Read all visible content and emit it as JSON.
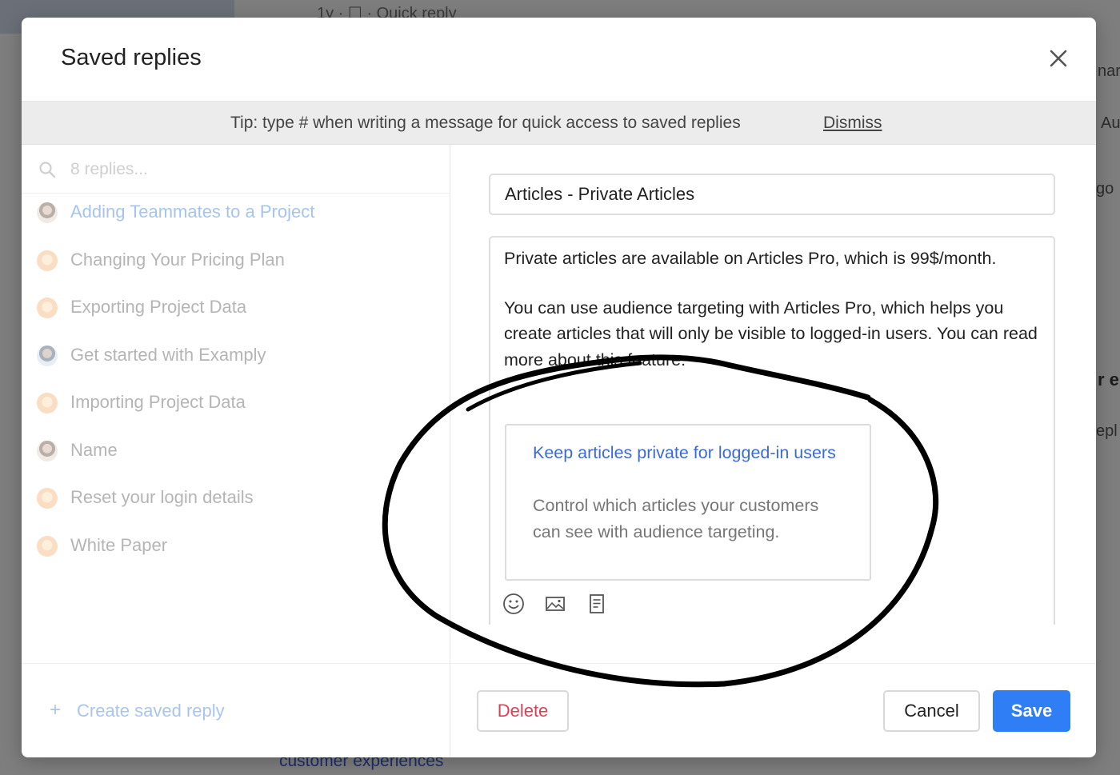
{
  "background": {
    "top_text": "1y · ☐ · Quick reply",
    "right_fragments": [
      "nar",
      "Au",
      "go",
      "r e",
      "epl"
    ],
    "bottom_text": "customer experiences"
  },
  "modal": {
    "title": "Saved replies",
    "close_icon": "close-icon"
  },
  "tip": {
    "text": "Tip: type # when writing a message for quick access to saved replies",
    "dismiss_label": "Dismiss"
  },
  "search": {
    "placeholder": "8 replies...",
    "icon": "search-icon"
  },
  "replies": [
    {
      "label": "Adding Teammates to a Project",
      "active": true,
      "avatar": "person-photo"
    },
    {
      "label": "Changing Your Pricing Plan",
      "active": false,
      "avatar": "illustrated-face"
    },
    {
      "label": "Exporting Project Data",
      "active": false,
      "avatar": "illustrated-face"
    },
    {
      "label": "Get started with Examply",
      "active": false,
      "avatar": "person-photo-blue"
    },
    {
      "label": "Importing Project Data",
      "active": false,
      "avatar": "illustrated-face"
    },
    {
      "label": "Name",
      "active": false,
      "avatar": "person-photo"
    },
    {
      "label": "Reset your login details",
      "active": false,
      "avatar": "illustrated-face"
    },
    {
      "label": "White Paper",
      "active": false,
      "avatar": "illustrated-face"
    }
  ],
  "create_reply_label": "Create saved reply",
  "editor": {
    "title_value": "Articles - Private Articles",
    "paragraphs": [
      "Private articles are available on Articles Pro, which is 99$/month.",
      "You can use audience targeting with Articles Pro, which helps you create articles that will only be visible to logged-in users. You can read more about this feature:"
    ],
    "link_card": {
      "title": "Keep articles private for logged-in users",
      "description": "Control which articles your customers can see with audience targeting."
    },
    "toolbar": [
      "emoji-icon",
      "image-icon",
      "article-icon"
    ]
  },
  "actions": {
    "delete_label": "Delete",
    "cancel_label": "Cancel",
    "save_label": "Save"
  },
  "colors": {
    "accent": "#2f7ef6",
    "danger": "#e23d56",
    "link": "#3b6bd6",
    "active_item": "#a5c4ef"
  }
}
